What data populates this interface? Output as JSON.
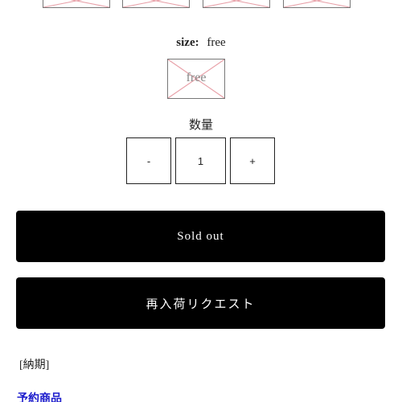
{
  "colors": {
    "button_bg": "#000000",
    "button_text": "#ffffff",
    "link": "#1a1acc",
    "placeholder_cross": "#e8a0a8"
  },
  "swatches": {
    "icon": "broken-image-icon",
    "count": 4
  },
  "size": {
    "key": "size:",
    "value": "free",
    "option_alt": "free"
  },
  "quantity": {
    "label": "数量",
    "minus": "-",
    "value": "1",
    "plus": "+"
  },
  "buttons": {
    "sold_out": "Sold out",
    "restock_request": "再入荷リクエスト"
  },
  "delivery": {
    "label": "[納期]",
    "preorder": "予約商品"
  }
}
